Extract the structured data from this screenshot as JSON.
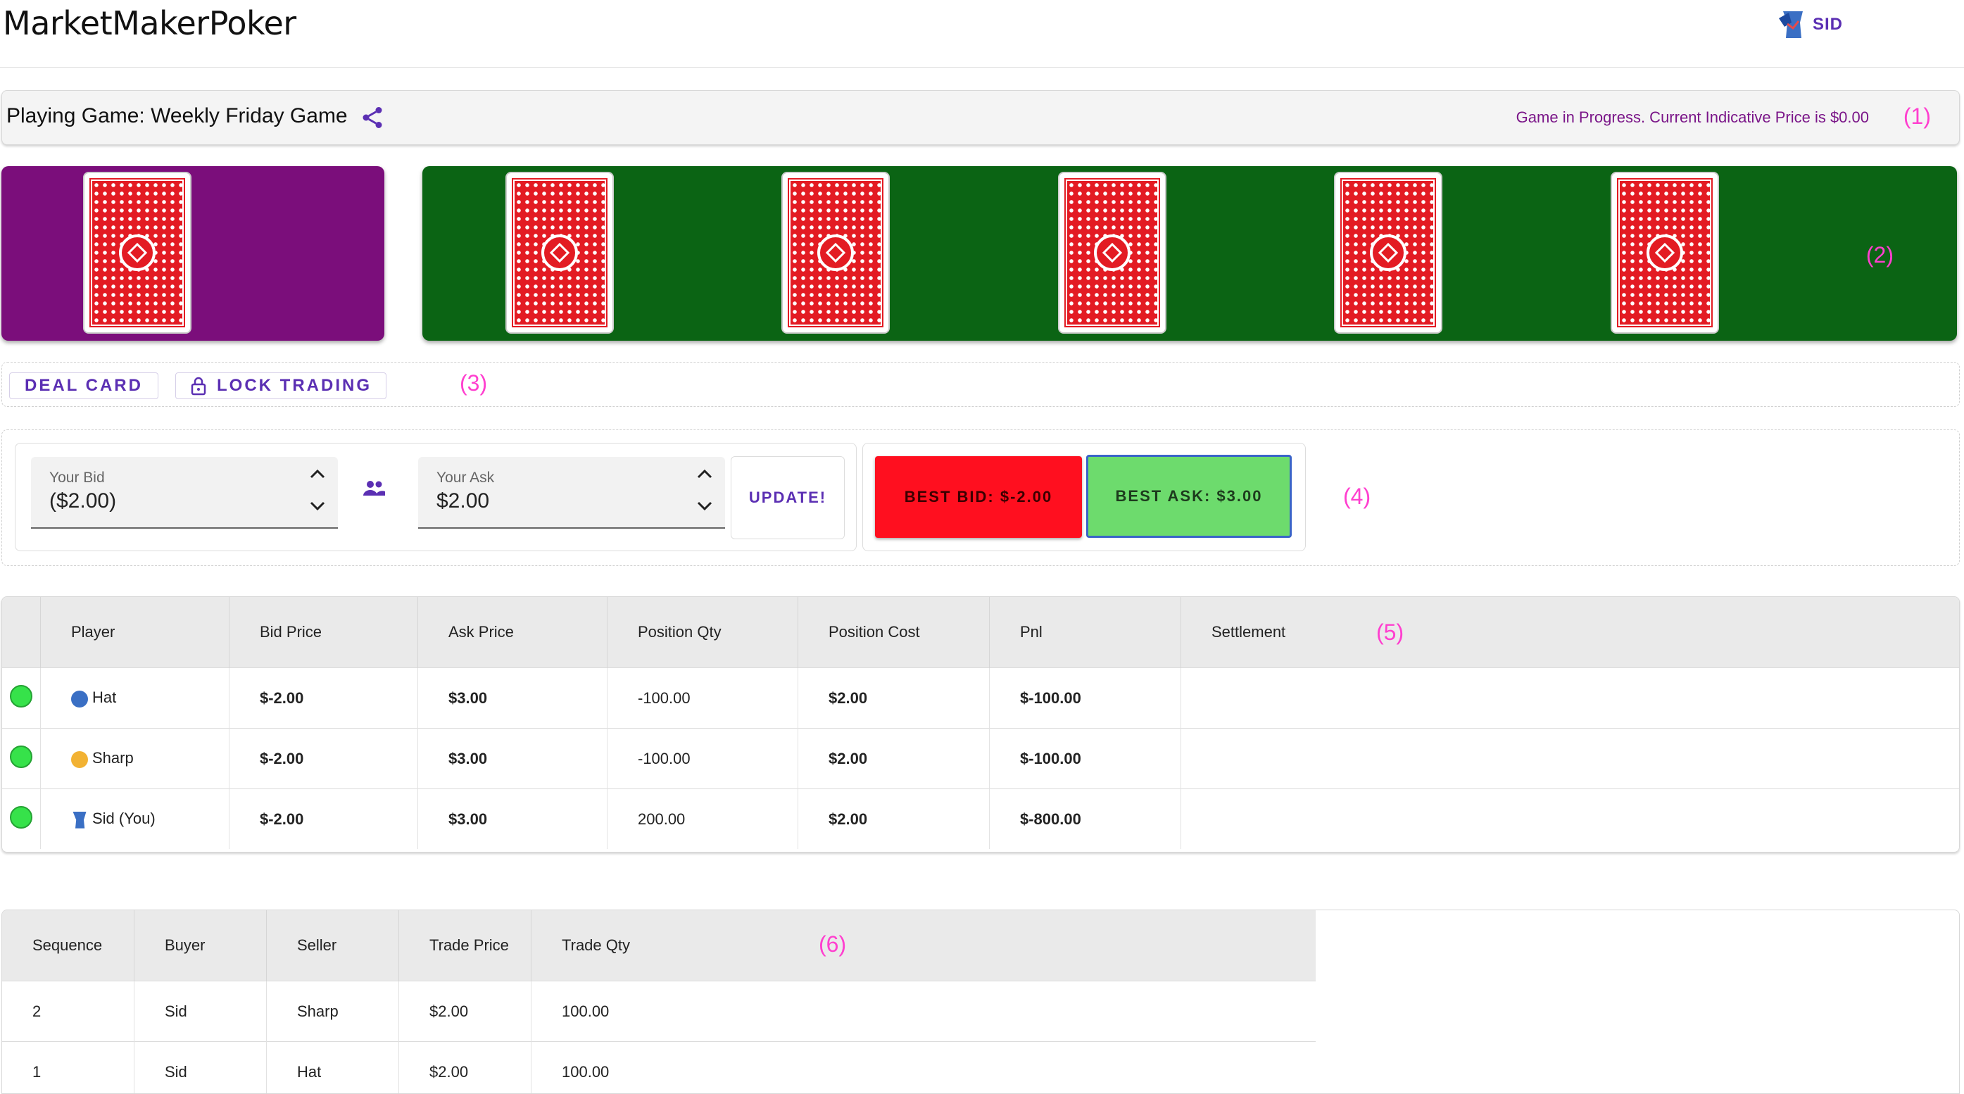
{
  "header": {
    "logo": "MarketMakerPoker",
    "user_name": "SID"
  },
  "game_bar": {
    "title": "Playing Game: Weekly Friday Game",
    "status": "Game in Progress. Current Indicative Price is $0.00",
    "annotation": "(1)"
  },
  "cards": {
    "player_cards": 1,
    "board_cards": 5,
    "annotation": "(2)"
  },
  "controls": {
    "deal_label": "DEAL CARD",
    "lock_label": "LOCK TRADING",
    "annotation": "(3)"
  },
  "quote": {
    "bid_label": "Your Bid",
    "bid_value": "($2.00)",
    "ask_label": "Your Ask",
    "ask_value": "$2.00",
    "update_label": "UPDATE!",
    "best_bid": "BEST BID: $-2.00",
    "best_ask": "BEST ASK: $3.00",
    "annotation": "(4)"
  },
  "players_table": {
    "annotation": "(5)",
    "headers": [
      "",
      "Player",
      "Bid Price",
      "Ask Price",
      "Position Qty",
      "Position Cost",
      "Pnl",
      "Settlement"
    ],
    "rows": [
      {
        "player": "Hat",
        "bid": "$-2.00",
        "ask": "$3.00",
        "qty": "-100.00",
        "cost": "$2.00",
        "pnl": "$-100.00",
        "settlement": ""
      },
      {
        "player": "Sharp",
        "bid": "$-2.00",
        "ask": "$3.00",
        "qty": "-100.00",
        "cost": "$2.00",
        "pnl": "$-100.00",
        "settlement": ""
      },
      {
        "player": "Sid (You)",
        "bid": "$-2.00",
        "ask": "$3.00",
        "qty": "200.00",
        "cost": "$2.00",
        "pnl": "$-800.00",
        "settlement": ""
      }
    ]
  },
  "trades_table": {
    "annotation": "(6)",
    "headers": [
      "Sequence",
      "Buyer",
      "Seller",
      "Trade Price",
      "Trade Qty"
    ],
    "rows": [
      {
        "seq": "2",
        "buyer": "Sid",
        "seller": "Sharp",
        "price": "$2.00",
        "qty": "100.00"
      },
      {
        "seq": "1",
        "buyer": "Sid",
        "seller": "Hat",
        "price": "$2.00",
        "qty": "100.00"
      }
    ]
  },
  "colors": {
    "accent": "#5b2fb3",
    "player_area": "#7b0e7b",
    "board_area": "#0b6414",
    "best_bid": "#ff0f1f",
    "best_ask": "#6ddb6d",
    "annotation": "#ff3fcf"
  }
}
